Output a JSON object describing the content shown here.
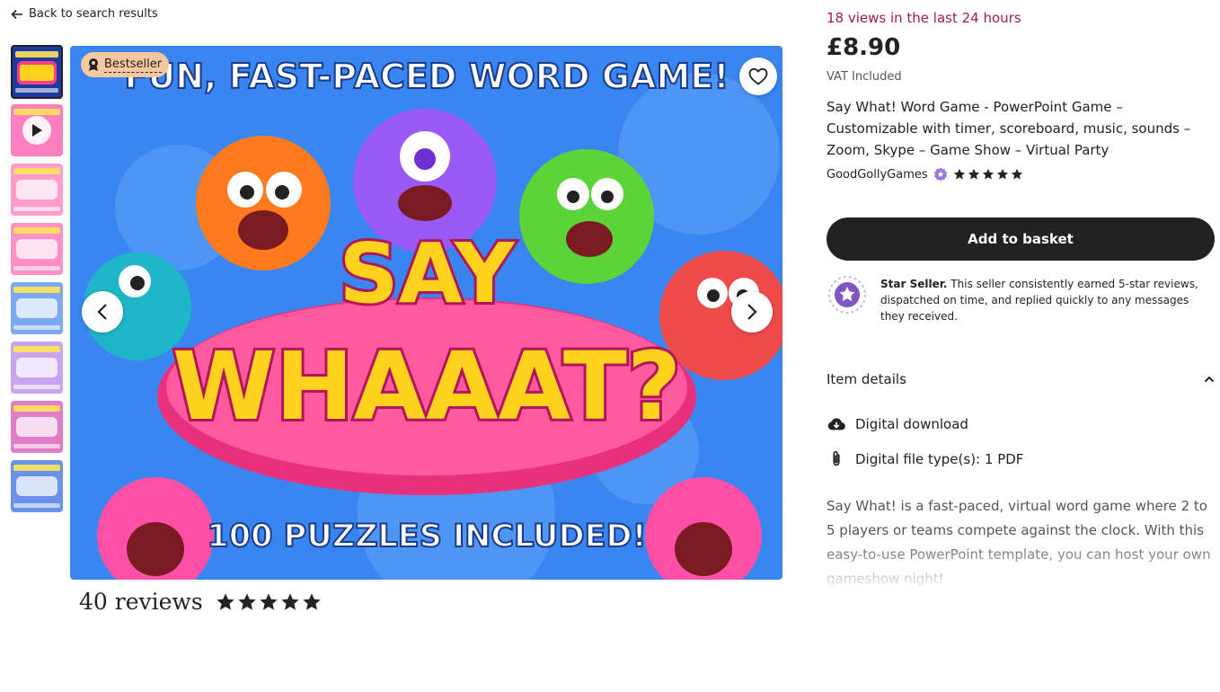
{
  "nav": {
    "back_label": "Back to search results"
  },
  "gallery": {
    "badge": "Bestseller",
    "image_text": {
      "headline": "FUN, FAST-PACED WORD GAME!",
      "line1": "SAY",
      "line2": "WHAAAT?",
      "footer": "100 PUZZLES INCLUDED!"
    },
    "thumbnail_count": 8,
    "colors": {
      "background": "#3a86f0",
      "title": "#ffd21f",
      "pink": "#ff3d8b"
    }
  },
  "reviews": {
    "count_label": "40 reviews",
    "rating": 5
  },
  "product": {
    "views": "18 views in the last 24 hours",
    "price": "£8.90",
    "vat": "VAT Included",
    "title": "Say What! Word Game - PowerPoint Game – Customizable with timer, scoreboard, music, sounds – Zoom, Skype – Game Show – Virtual Party",
    "shop_name": "GoodGollyGames",
    "shop_rating": 5,
    "add_to_basket": "Add to basket",
    "star_seller_title": "Star Seller.",
    "star_seller_text": " This seller consistently earned 5-star reviews, dispatched on time, and replied quickly to any messages they received.",
    "item_details_label": "Item details",
    "details": [
      {
        "icon": "download-cloud-icon",
        "label": "Digital download"
      },
      {
        "icon": "paperclip-icon",
        "label": "Digital file type(s): 1 PDF"
      }
    ],
    "description": "Say What! is a fast-paced, virtual word game where 2 to 5 players or teams compete against the clock. With this easy-to-use PowerPoint template, you can host your own gameshow night!"
  },
  "colors": {
    "accent_views": "#a61a4a",
    "button": "#222222",
    "star_seller": "#7f56c5"
  }
}
